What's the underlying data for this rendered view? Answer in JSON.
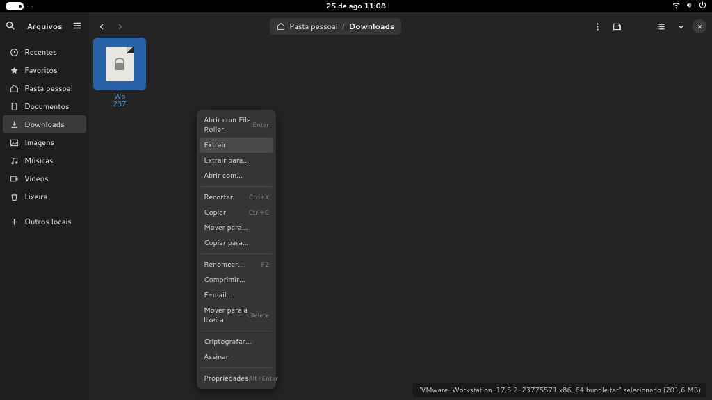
{
  "topbar": {
    "datetime": "25 de ago  11:08"
  },
  "sidebar": {
    "title": "Arquivos",
    "items": [
      {
        "icon": "clock-icon",
        "label": "Recentes"
      },
      {
        "icon": "star-icon",
        "label": "Favoritos"
      },
      {
        "icon": "home-icon",
        "label": "Pasta pessoal"
      },
      {
        "icon": "document-icon",
        "label": "Documentos"
      },
      {
        "icon": "download-icon",
        "label": "Downloads",
        "active": true
      },
      {
        "icon": "image-icon",
        "label": "Imagens"
      },
      {
        "icon": "music-icon",
        "label": "Músicas"
      },
      {
        "icon": "video-icon",
        "label": "Vídeos"
      },
      {
        "icon": "trash-icon",
        "label": "Lixeira"
      }
    ],
    "other_locations": "Outros locais"
  },
  "path": {
    "home": "Pasta pessoal",
    "current": "Downloads"
  },
  "file": {
    "line1": "Wo",
    "line2": "237"
  },
  "context_menu": {
    "groups": [
      [
        {
          "label": "Abrir com File Roller",
          "shortcut": "Enter"
        },
        {
          "label": "Extrair",
          "hover": true
        },
        {
          "label": "Extrair para…"
        },
        {
          "label": "Abrir com…"
        }
      ],
      [
        {
          "label": "Recortar",
          "shortcut": "Ctrl+X"
        },
        {
          "label": "Copiar",
          "shortcut": "Ctrl+C"
        },
        {
          "label": "Mover para…"
        },
        {
          "label": "Copiar para…"
        }
      ],
      [
        {
          "label": "Renomear…",
          "shortcut": "F2"
        },
        {
          "label": "Comprimir…"
        },
        {
          "label": "E-mail…"
        },
        {
          "label": "Mover para a lixeira",
          "shortcut": "Delete"
        }
      ],
      [
        {
          "label": "Criptografar…"
        },
        {
          "label": "Assinar"
        }
      ],
      [
        {
          "label": "Propriedades",
          "shortcut": "Alt+Enter"
        }
      ]
    ]
  },
  "status": "\"VMware-Workstation-17.5.2-23775571.x86_64.bundle.tar\" selecionado  (201,6 MB)"
}
